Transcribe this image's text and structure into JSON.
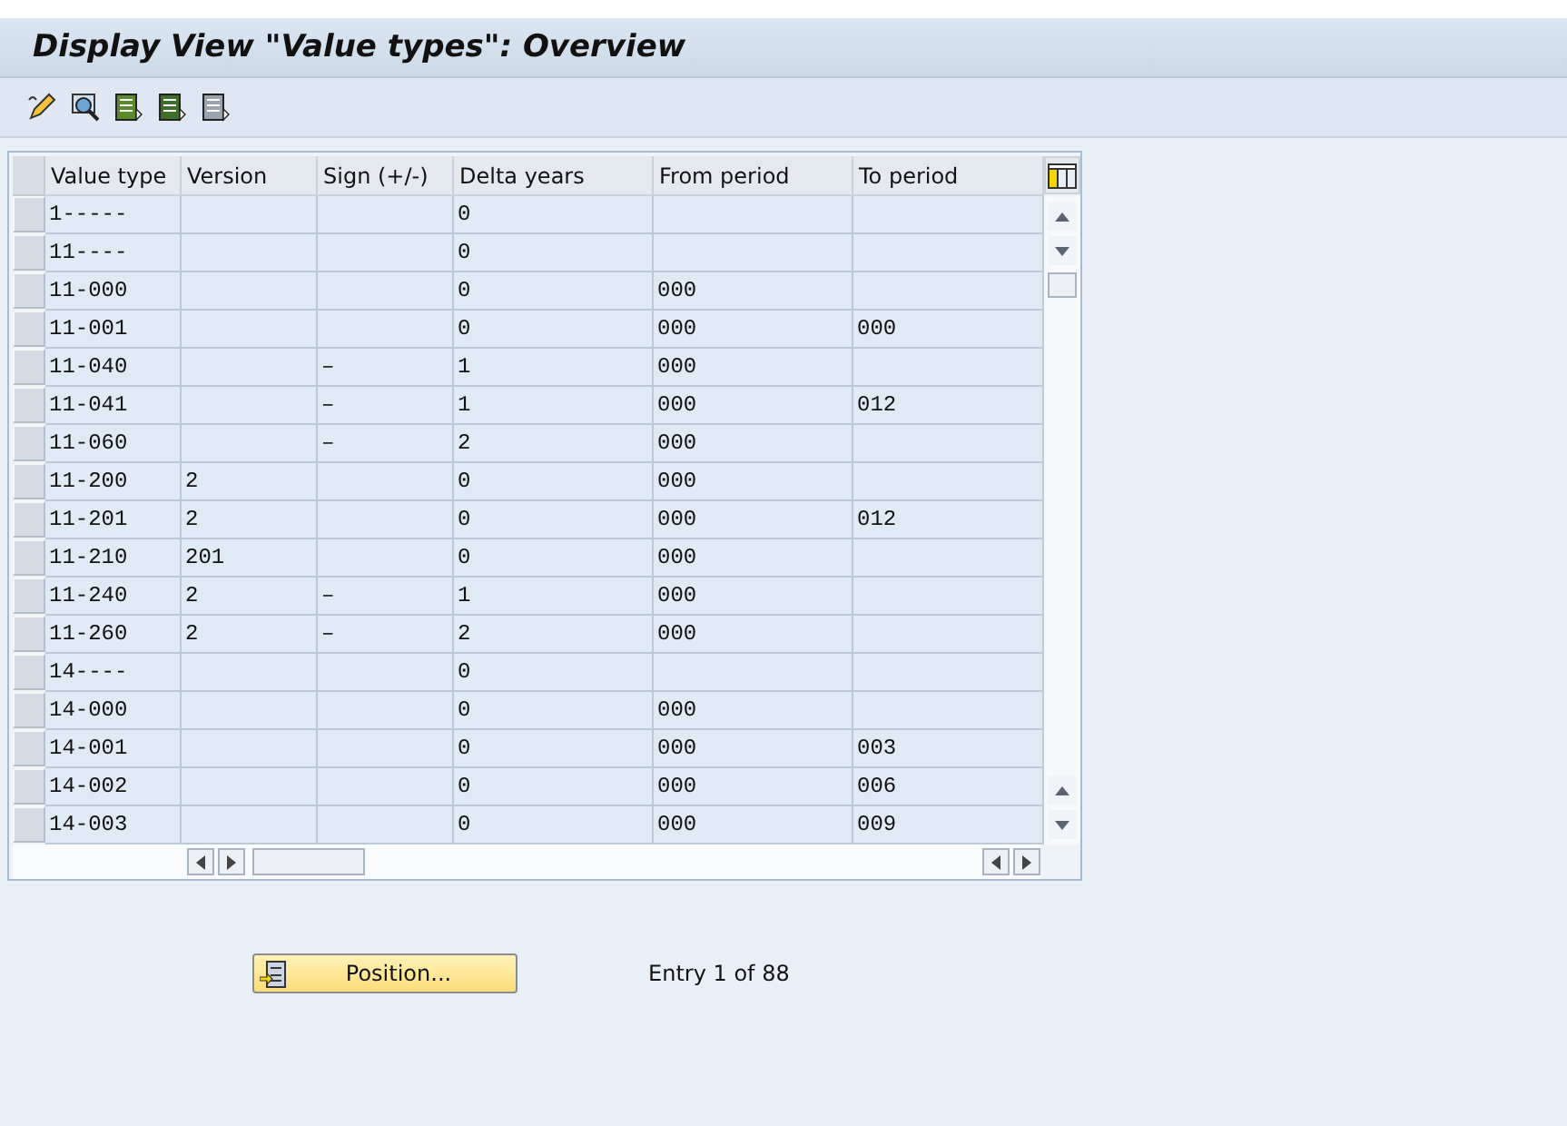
{
  "window": {
    "title": "Display View \"Value types\": Overview"
  },
  "table": {
    "columns": [
      "Value type",
      "Version",
      "Sign (+/-)",
      "Delta years",
      "From period",
      "To period"
    ],
    "rows": [
      [
        "1-----",
        "",
        "",
        "0",
        "",
        ""
      ],
      [
        "11----",
        "",
        "",
        "0",
        "",
        ""
      ],
      [
        "11-000",
        "",
        "",
        "0",
        "000",
        ""
      ],
      [
        "11-001",
        "",
        "",
        "0",
        "000",
        "000"
      ],
      [
        "11-040",
        "",
        "–",
        "1",
        "000",
        ""
      ],
      [
        "11-041",
        "",
        "–",
        "1",
        "000",
        "012"
      ],
      [
        "11-060",
        "",
        "–",
        "2",
        "000",
        ""
      ],
      [
        "11-200",
        "2",
        "",
        "0",
        "000",
        ""
      ],
      [
        "11-201",
        "2",
        "",
        "0",
        "000",
        "012"
      ],
      [
        "11-210",
        "201",
        "",
        "0",
        "000",
        ""
      ],
      [
        "11-240",
        "2",
        "–",
        "1",
        "000",
        ""
      ],
      [
        "11-260",
        "2",
        "–",
        "2",
        "000",
        ""
      ],
      [
        "14----",
        "",
        "",
        "0",
        "",
        ""
      ],
      [
        "14-000",
        "",
        "",
        "0",
        "000",
        ""
      ],
      [
        "14-001",
        "",
        "",
        "0",
        "000",
        "003"
      ],
      [
        "14-002",
        "",
        "",
        "0",
        "000",
        "006"
      ],
      [
        "14-003",
        "",
        "",
        "0",
        "000",
        "009"
      ]
    ]
  },
  "position_button": {
    "label": "Position..."
  },
  "entry_info": "Entry 1 of 88"
}
